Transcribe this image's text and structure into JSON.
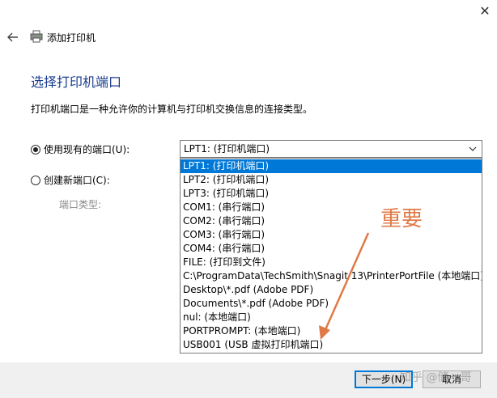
{
  "window": {
    "close_glyph": "✕",
    "title": "添加打印机",
    "icons": {
      "back": "back-arrow-icon",
      "printer": "printer-icon",
      "close": "close-icon"
    }
  },
  "main": {
    "heading": "选择打印机端口",
    "description": "打印机端口是一种允许你的计算机与打印机交换信息的连接类型。",
    "options": {
      "existing_label": "使用现有的端口(U):",
      "existing_checked": true,
      "new_label": "创建新端口(C):",
      "new_checked": false,
      "port_type_label": "端口类型:"
    },
    "select": {
      "value": "LPT1: (打印机端口)",
      "items": [
        "LPT1: (打印机端口)",
        "LPT2: (打印机端口)",
        "LPT3: (打印机端口)",
        "COM1: (串行端口)",
        "COM2: (串行端口)",
        "COM3: (串行端口)",
        "COM4: (串行端口)",
        "FILE: (打印到文件)",
        "C:\\ProgramData\\TechSmith\\Snagit 13\\PrinterPortFile (本地端口)",
        "Desktop\\*.pdf (Adobe PDF)",
        "Documents\\*.pdf (Adobe PDF)",
        "nul: (本地端口)",
        "PORTPROMPT: (本地端口)",
        "USB001 (USB 虚拟打印机端口)"
      ],
      "selected_index": 0
    }
  },
  "annotation": {
    "text": "重要",
    "color": "#e07a47"
  },
  "footer": {
    "next_label": "下一步(N)",
    "cancel_label": "取消"
  },
  "watermark": {
    "text": "知乎 @储一哥"
  },
  "colors": {
    "accent": "#0078d7",
    "heading": "#1a3d8f"
  }
}
